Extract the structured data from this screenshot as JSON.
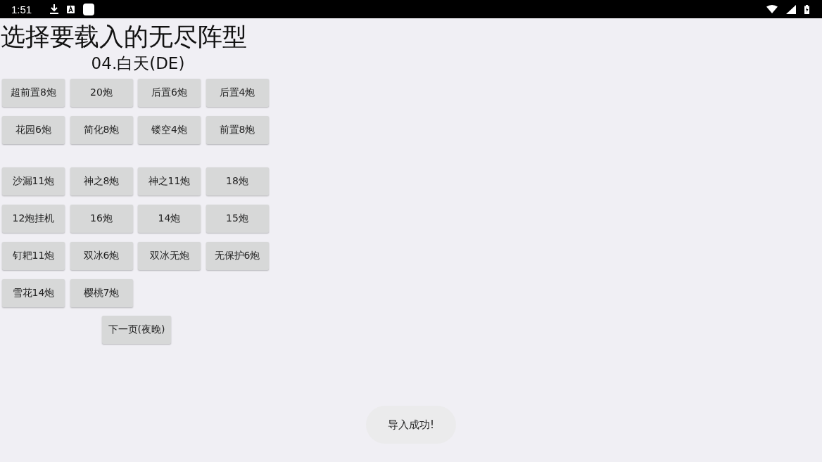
{
  "status_bar": {
    "time": "1:51"
  },
  "title": "选择要载入的无尽阵型",
  "subtitle": "04.白天(DE)",
  "button_groups": [
    [
      "超前置8炮",
      "20炮",
      "后置6炮",
      "后置4炮",
      "花园6炮",
      "简化8炮",
      "镂空4炮",
      "前置8炮"
    ],
    [
      "沙漏11炮",
      "神之8炮",
      "神之11炮",
      "18炮",
      "12炮挂机",
      "16炮",
      "14炮",
      "15炮",
      "钉耙11炮",
      "双冰6炮",
      "双冰无炮",
      "无保护6炮",
      "雪花14炮",
      "樱桃7炮"
    ]
  ],
  "next_button": "下一页(夜晚)",
  "toast": "导入成功!"
}
